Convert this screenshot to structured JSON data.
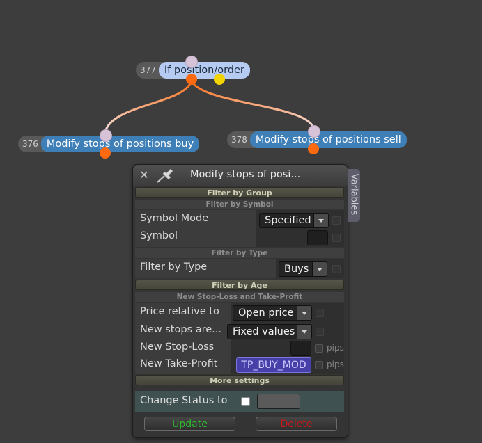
{
  "nodes": [
    {
      "id": "377",
      "label": "If position/order"
    },
    {
      "id": "376",
      "label": "Modify stops of positions buy"
    },
    {
      "id": "378",
      "label": "Modify stops of positions sell"
    }
  ],
  "panel": {
    "title": "Modify stops of posi...",
    "variables_tab": "Variables",
    "sections": {
      "filter_group": "Filter by Group",
      "filter_symbol": "Filter by Symbol",
      "filter_type": "Filter by Type",
      "filter_age": "Filter by Age",
      "new_sl_tp": "New Stop-Loss and Take-Profit",
      "more": "More settings"
    },
    "fields": {
      "symbol_mode": {
        "label": "Symbol Mode",
        "value": "Specified"
      },
      "symbol": {
        "label": "Symbol",
        "value": ""
      },
      "filter_type": {
        "label": "Filter by Type",
        "value": "Buys"
      },
      "price_relative": {
        "label": "Price relative to",
        "value": "Open price"
      },
      "new_stops_are": {
        "label": "New stops are...",
        "value": "Fixed values"
      },
      "new_sl": {
        "label": "New Stop-Loss",
        "value": "",
        "unit": "pips"
      },
      "new_tp": {
        "label": "New Take-Profit",
        "value": "TP_BUY_MOD",
        "unit": "pips"
      },
      "change_status": {
        "label": "Change Status to",
        "checked": false,
        "value": ""
      }
    },
    "buttons": {
      "update": "Update",
      "delete": "Delete"
    }
  },
  "colors": {
    "background": "#3d3d3d",
    "node_output_pin": "#ff6a10",
    "node_alt_pin": "#f2d400",
    "update_text": "#2fbf2f",
    "delete_text": "#c81818",
    "variable_field": "#4640a8"
  }
}
